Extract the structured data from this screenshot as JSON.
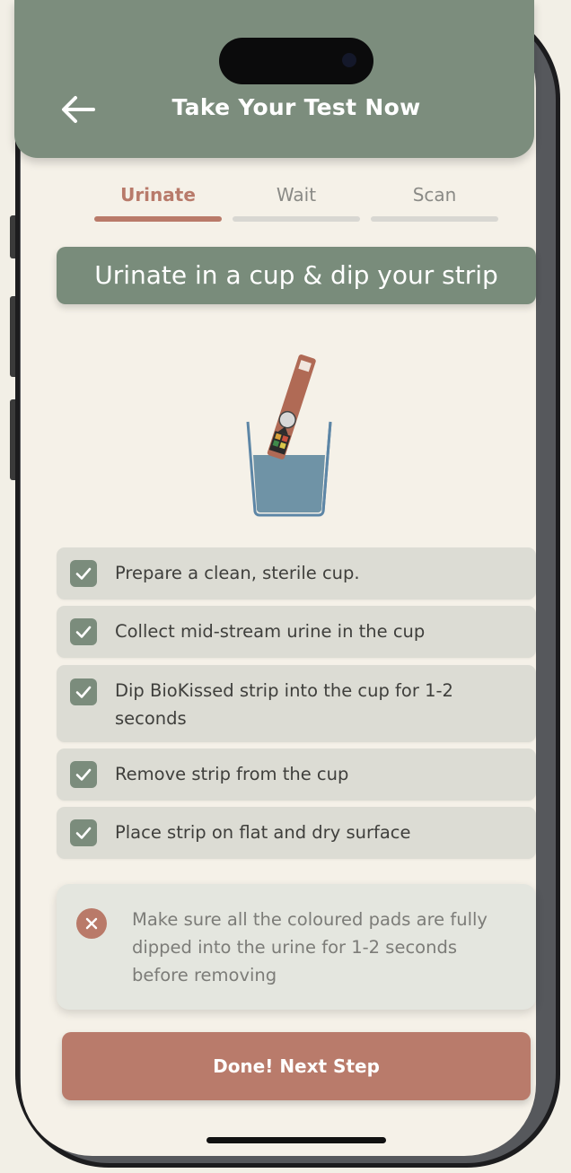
{
  "header": {
    "title": "Take Your Test Now",
    "back_icon": "arrow-left-icon"
  },
  "tabs": [
    {
      "label": "Urinate",
      "active": true
    },
    {
      "label": "Wait",
      "active": false
    },
    {
      "label": "Scan",
      "active": false
    }
  ],
  "step": {
    "banner": "Urinate in a cup & dip your strip",
    "illustration_icon": "strip-in-cup-icon"
  },
  "checklist": [
    {
      "text": "Prepare a clean, sterile cup.",
      "checked": true
    },
    {
      "text": "Collect mid-stream urine in the cup",
      "checked": true
    },
    {
      "text": "Dip BioKissed strip into the cup for 1-2 seconds",
      "checked": true
    },
    {
      "text": "Remove strip from the cup",
      "checked": true
    },
    {
      "text": "Place strip on flat and dry surface",
      "checked": true
    }
  ],
  "warning": {
    "icon": "close-circle-icon",
    "text": "Make sure all the coloured pads are fully dipped into the urine for 1-2 seconds before removing"
  },
  "cta": {
    "label": "Done! Next Step"
  },
  "colors": {
    "header": "#7c8d7d",
    "accent": "#b97a69",
    "background": "#f5f1e8",
    "checklist_bg": "#dcdcd4",
    "checkbox": "#7b8c7c"
  }
}
